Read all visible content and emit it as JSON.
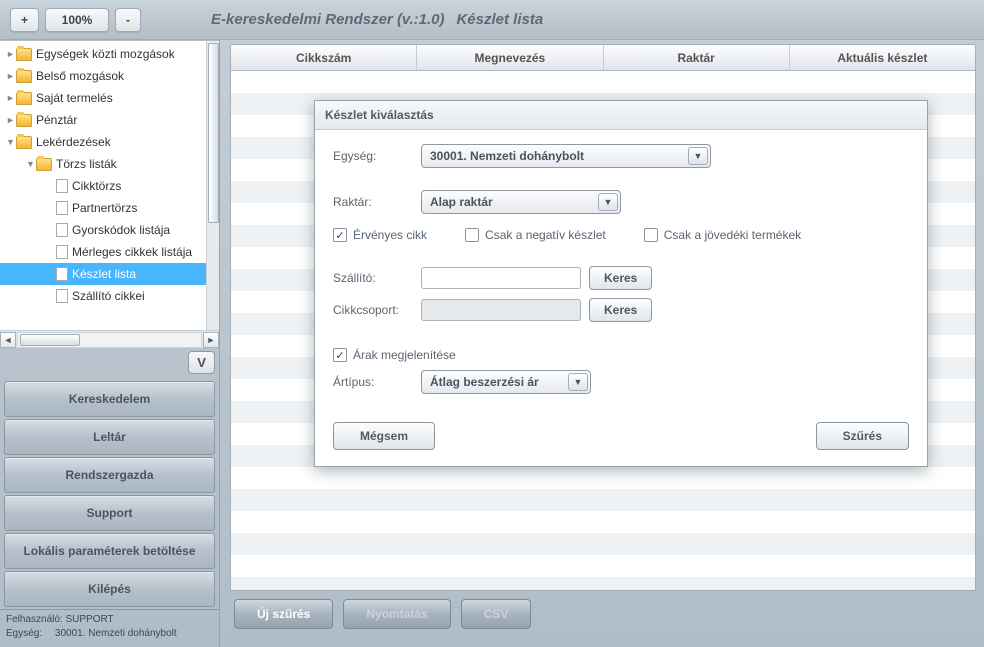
{
  "header": {
    "zoom_out": "+",
    "zoom_pct": "100%",
    "zoom_in": "-",
    "app_title": "E-kereskedelmi Rendszer (v.:1.0)",
    "page_title": "Készlet lista"
  },
  "tree": {
    "items": [
      {
        "caret": "►",
        "type": "folder",
        "label": "Egységek közti mozgások",
        "indent": 0
      },
      {
        "caret": "►",
        "type": "folder",
        "label": "Belső mozgások",
        "indent": 0
      },
      {
        "caret": "►",
        "type": "folder",
        "label": "Saját termelés",
        "indent": 0
      },
      {
        "caret": "►",
        "type": "folder",
        "label": "Pénztár",
        "indent": 0
      },
      {
        "caret": "▼",
        "type": "folder",
        "label": "Lekérdezések",
        "indent": 0
      },
      {
        "caret": "▼",
        "type": "folder",
        "label": "Törzs listák",
        "indent": 1
      },
      {
        "caret": "",
        "type": "file",
        "label": "Cikktörzs",
        "indent": 2
      },
      {
        "caret": "",
        "type": "file",
        "label": "Partnertörzs",
        "indent": 2
      },
      {
        "caret": "",
        "type": "file",
        "label": "Gyorskódok listája",
        "indent": 2
      },
      {
        "caret": "",
        "type": "file",
        "label": "Mérleges cikkek listája",
        "indent": 2
      },
      {
        "caret": "",
        "type": "file",
        "label": "Készlet lista",
        "indent": 2,
        "selected": true
      },
      {
        "caret": "",
        "type": "dims",
        "label": "Szállító cikkei",
        "indent": 2
      }
    ],
    "toggle_btn": "V"
  },
  "module_buttons": [
    "Kereskedelem",
    "Leltár",
    "Rendszergazda",
    "Support",
    "Lokális paraméterek betöltése",
    "Kilépés"
  ],
  "status": {
    "user_label": "Felhasználó:",
    "user_value": "SUPPORT",
    "unit_label": "Egység:",
    "unit_value": "30001. Nemzeti dohánybolt"
  },
  "table": {
    "columns": [
      "Cikkszám",
      "Megnevezés",
      "Raktár",
      "Aktuális készlet"
    ]
  },
  "bottom": {
    "new_filter": "Új szűrés",
    "print": "Nyomtatás",
    "csv": "CSV"
  },
  "dialog": {
    "title": "Készlet kiválasztás",
    "unit_label": "Egység:",
    "unit_value": "30001. Nemzeti dohánybolt",
    "store_label": "Raktár:",
    "store_value": "Alap raktár",
    "chk_valid": "Érvényes cikk",
    "chk_neg": "Csak a negatív készlet",
    "chk_jov": "Csak a jövedéki termékek",
    "supplier_label": "Szállító:",
    "group_label": "Cikkcsoport:",
    "search_btn": "Keres",
    "chk_prices": "Árak megjelenítése",
    "ptype_label": "Ártípus:",
    "ptype_value": "Átlag beszerzési ár",
    "cancel": "Mégsem",
    "filter": "Szűrés"
  }
}
